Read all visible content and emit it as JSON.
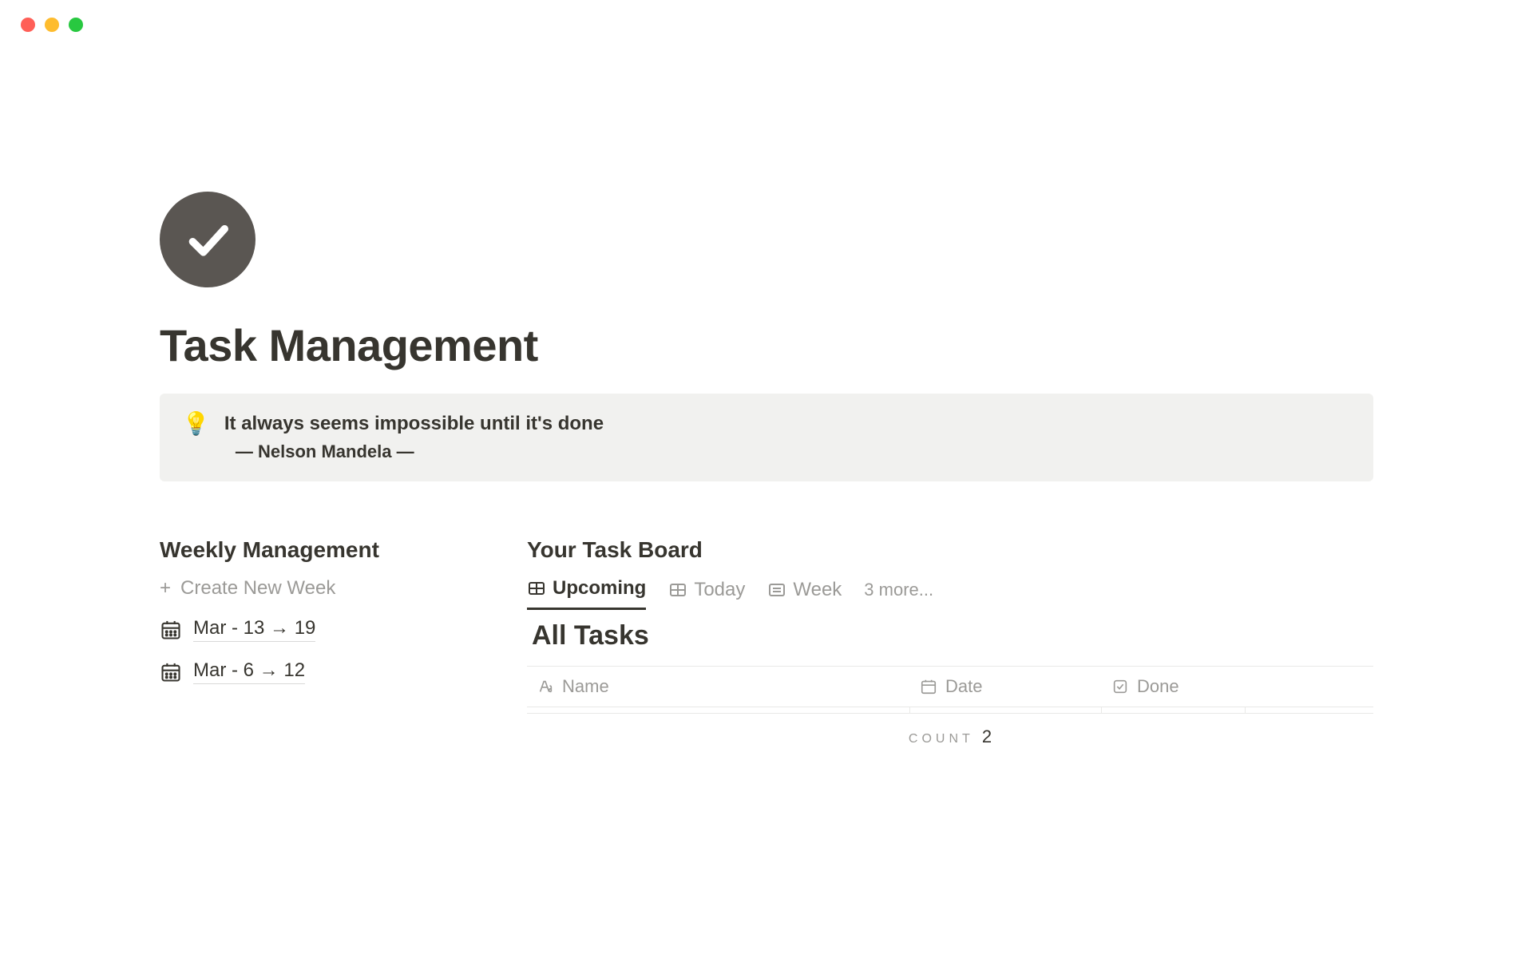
{
  "page": {
    "title": "Task Management"
  },
  "callout": {
    "icon": "💡",
    "quote": "It always seems impossible until it's done",
    "attribution": "— Nelson Mandela —"
  },
  "weekly": {
    "title": "Weekly Management",
    "create_label": "Create New Week",
    "items": [
      {
        "label": "Mar - 13 → 19"
      },
      {
        "label": "Mar - 6 → 12"
      }
    ]
  },
  "board": {
    "title": "Your Task Board",
    "tabs": [
      {
        "label": "Upcoming",
        "icon": "table",
        "active": true
      },
      {
        "label": "Today",
        "icon": "table",
        "active": false
      },
      {
        "label": "Week",
        "icon": "list",
        "active": false
      }
    ],
    "more_label": "3 more...",
    "subtitle": "All Tasks",
    "columns": [
      {
        "label": "Name",
        "icon": "text"
      },
      {
        "label": "Date",
        "icon": "calendar"
      },
      {
        "label": "Done",
        "icon": "checkbox"
      }
    ],
    "count_label": "COUNT",
    "count_value": "2"
  }
}
